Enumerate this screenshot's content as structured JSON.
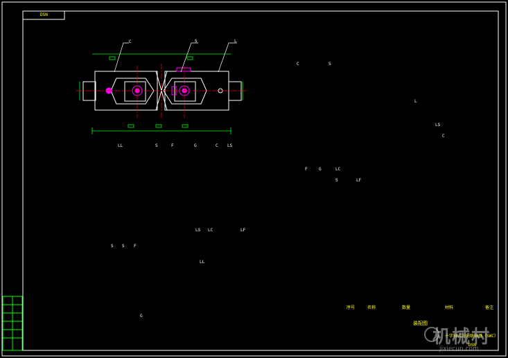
{
  "drawing": {
    "corner_tag": "DSN",
    "title_block": {
      "name": "装配图",
      "subtitle": "十字轴式万向联轴器（SWC）",
      "code": "DSN"
    },
    "parts_table": {
      "headers": [
        "序号",
        "名称",
        "数量",
        "材料",
        "备注"
      ]
    },
    "callouts": {
      "top_view": [
        "C",
        "S",
        "L"
      ],
      "section_view": [
        "LL",
        "S",
        "F",
        "G",
        "C",
        "LS",
        "LS",
        "LC",
        "LF"
      ],
      "end_view": [
        "S",
        "S",
        "F",
        "G"
      ],
      "round_view": [
        "LL"
      ],
      "iso_view": [
        "C",
        "S",
        "L",
        "LS",
        "C",
        "F",
        "G",
        "LC",
        "S",
        "LF"
      ]
    },
    "colors": {
      "border": "#ffffff",
      "outline": "#ffffff",
      "centerline": "#ff0000",
      "dimension": "#00ff00",
      "hatch": "#00ffff",
      "highlight": "#ff00ff",
      "text": "#ffff00"
    }
  }
}
